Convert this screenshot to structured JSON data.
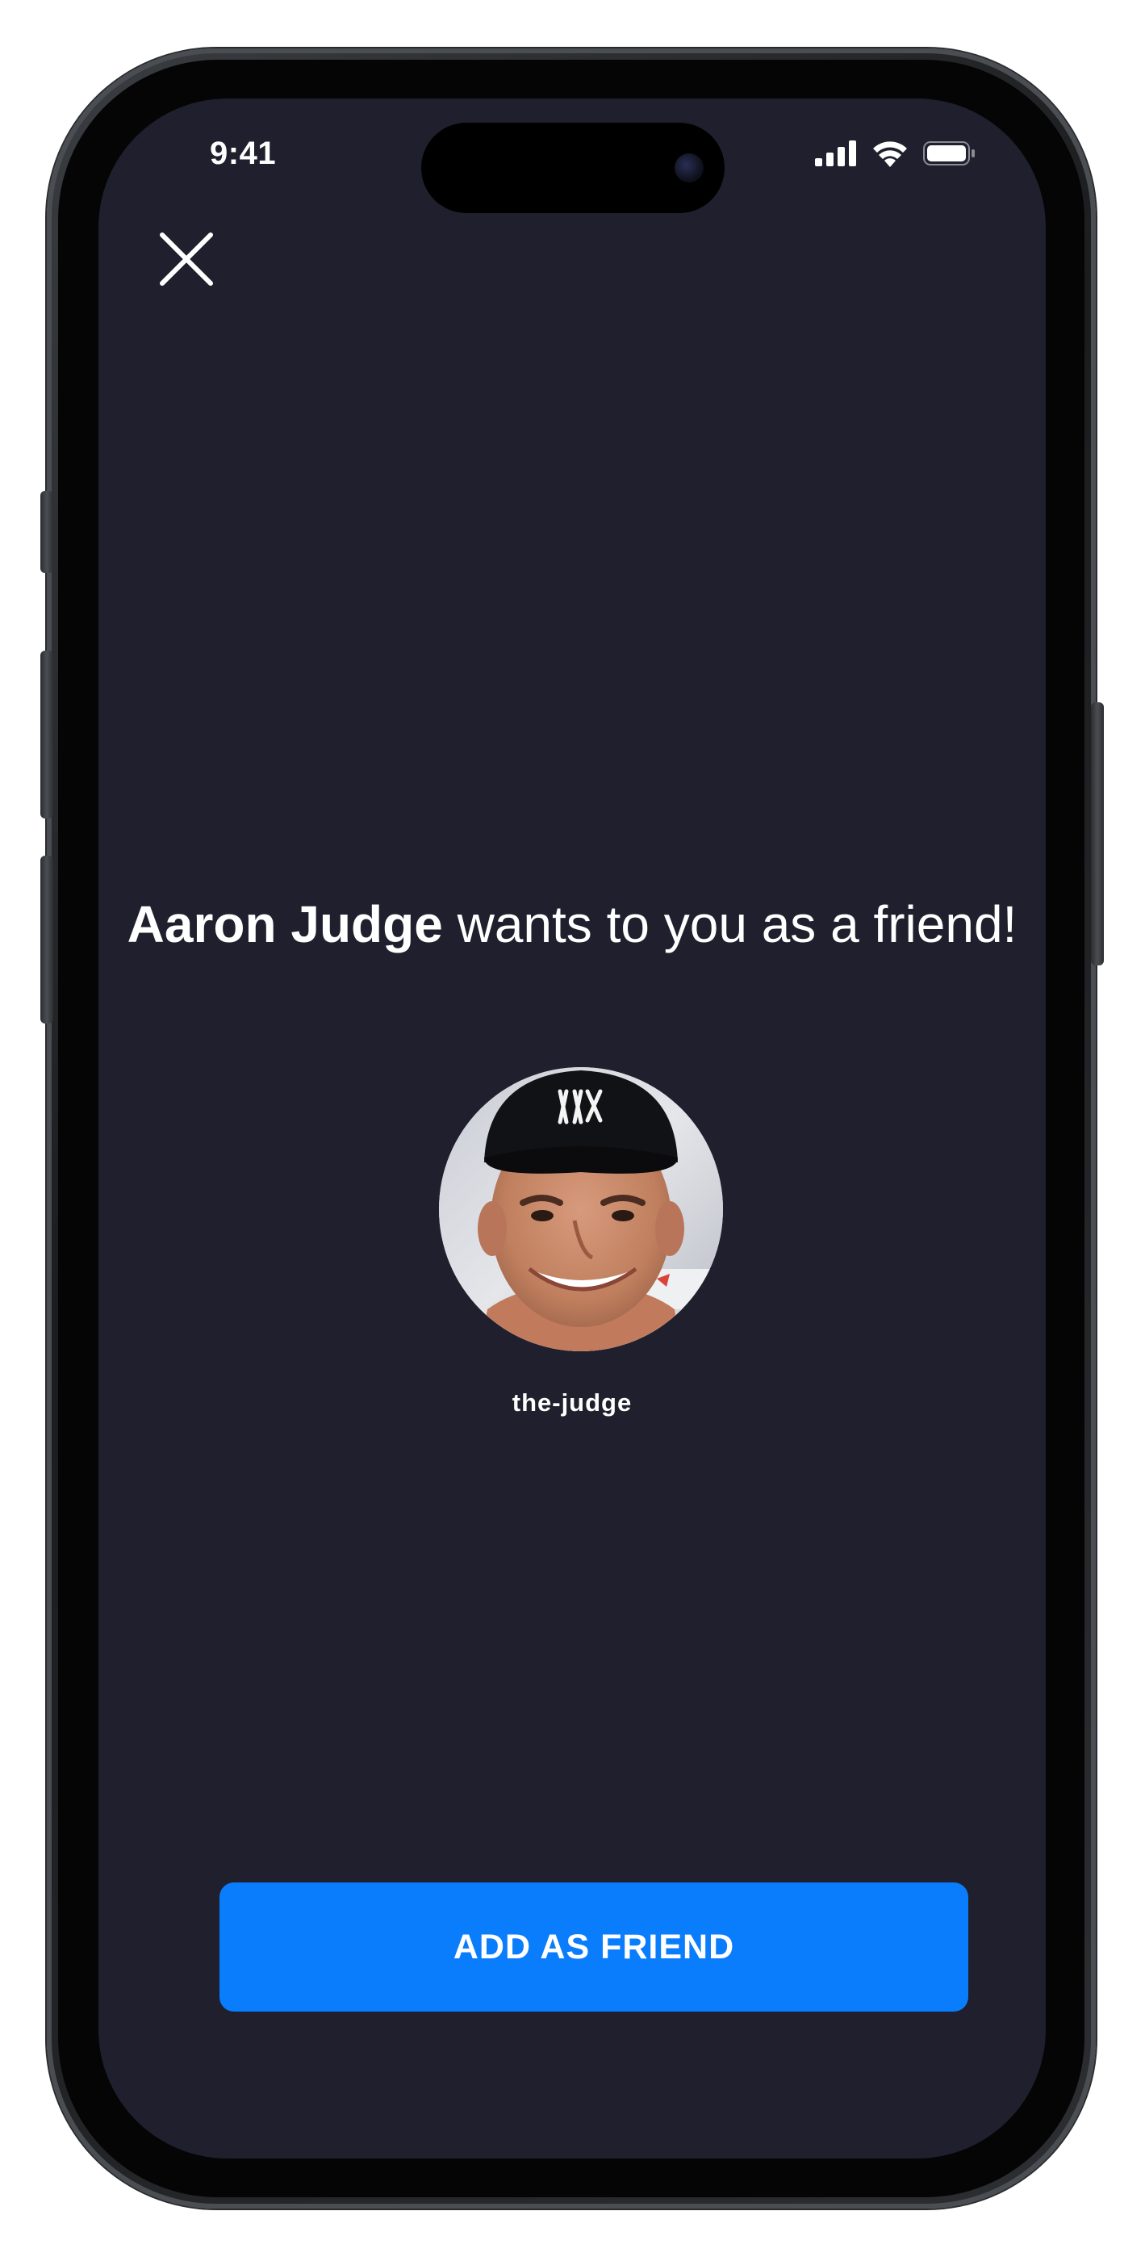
{
  "status_bar": {
    "time": "9:41",
    "icons": [
      "cellular-signal-icon",
      "wifi-icon",
      "battery-icon"
    ]
  },
  "header": {
    "close_icon": "close-icon"
  },
  "invite": {
    "sender_name": "Aaron Judge",
    "message": " wants to you as a friend!"
  },
  "profile": {
    "avatar_icon": "profile-photo",
    "username": "the-judge"
  },
  "actions": {
    "add_friend_label": "ADD AS FRIEND"
  },
  "colors": {
    "background": "#1f1f2d",
    "primary_button": "#0a7dfd",
    "text": "#ffffff"
  }
}
